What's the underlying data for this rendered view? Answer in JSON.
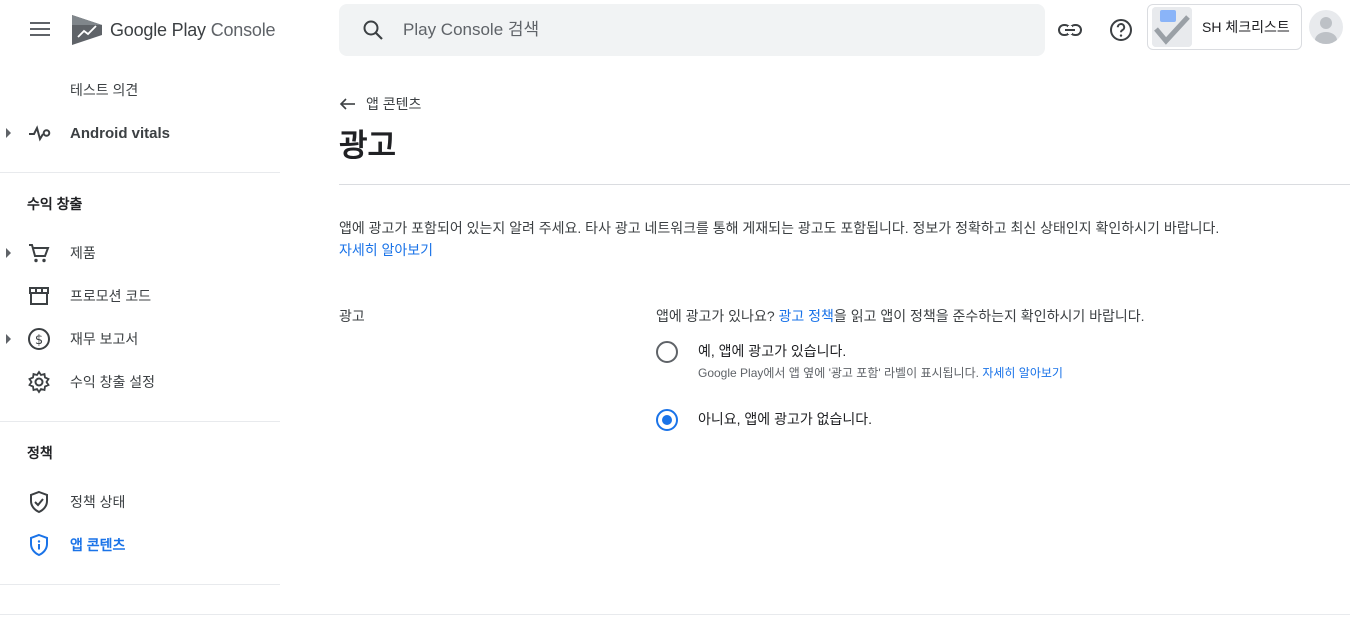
{
  "header": {
    "app_title_brand": "Google Play",
    "app_title_product": "Console",
    "search_placeholder": "Play Console 검색",
    "account_name": "SH 체크리스트"
  },
  "sidebar": {
    "items_top": [
      {
        "label": "테스트 의견"
      },
      {
        "label": "Android vitals"
      }
    ],
    "sections": [
      {
        "title": "수익 창출",
        "items": [
          {
            "label": "제품",
            "icon": "cart-icon"
          },
          {
            "label": "프로모션 코드",
            "icon": "store-icon"
          },
          {
            "label": "재무 보고서",
            "icon": "dollar-icon"
          },
          {
            "label": "수익 창출 설정",
            "icon": "gear-icon"
          }
        ]
      },
      {
        "title": "정책",
        "items": [
          {
            "label": "정책 상태",
            "icon": "shield-check-icon"
          },
          {
            "label": "앱 콘텐츠",
            "icon": "shield-info-icon"
          }
        ]
      }
    ]
  },
  "main": {
    "back_label": "앱 콘텐츠",
    "title": "광고",
    "intro_text": "앱에 광고가 포함되어 있는지 알려 주세요. 타사 광고 네트워크를 통해 게재되는 광고도 포함됩니다. 정보가 정확하고 최신 상태인지 확인하시기 바랍니다.",
    "intro_link": "자세히 알아보기",
    "field_label": "광고",
    "question_prefix": "앱에 광고가 있나요?",
    "question_link": "광고 정책",
    "question_suffix": "을 읽고 앱이 정책을 준수하는지 확인하시기 바랍니다.",
    "options": [
      {
        "label": "예, 앱에 광고가 있습니다.",
        "sub": "Google Play에서 앱 옆에 '광고 포함' 라벨이 표시됩니다.",
        "sub_link": "자세히 알아보기",
        "selected": false
      },
      {
        "label": "아니요, 앱에 광고가 없습니다.",
        "selected": true
      }
    ]
  },
  "colors": {
    "accent": "#1a73e8",
    "text": "#202124",
    "muted": "#5f6368"
  }
}
